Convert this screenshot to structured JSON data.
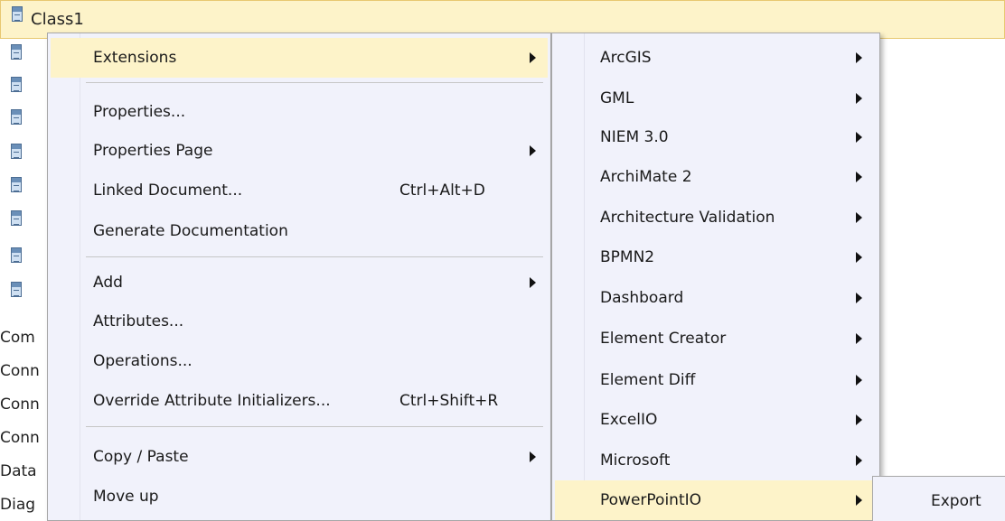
{
  "tree": {
    "root_label": "Class1",
    "items": [
      {
        "label": "Com"
      },
      {
        "label": "Conn"
      },
      {
        "label": "Conn"
      },
      {
        "label": "Conn"
      },
      {
        "label": "Data"
      },
      {
        "label": "Diag"
      }
    ]
  },
  "context_menu": {
    "items": [
      {
        "label": "Extensions",
        "submenu": true,
        "highlighted": true
      },
      {
        "label": "Properties..."
      },
      {
        "label": "Properties Page",
        "submenu": true
      },
      {
        "label": "Linked Document...",
        "shortcut": "Ctrl+Alt+D"
      },
      {
        "label": "Generate Documentation"
      },
      {
        "label": "Add",
        "submenu": true
      },
      {
        "label": "Attributes..."
      },
      {
        "label": "Operations..."
      },
      {
        "label": "Override Attribute Initializers...",
        "shortcut": "Ctrl+Shift+R"
      },
      {
        "label": "Copy / Paste",
        "submenu": true
      },
      {
        "label": "Move up"
      }
    ]
  },
  "extensions_menu": {
    "items": [
      {
        "label": "ArcGIS"
      },
      {
        "label": "GML"
      },
      {
        "label": "NIEM 3.0"
      },
      {
        "label": "ArchiMate 2"
      },
      {
        "label": "Architecture Validation"
      },
      {
        "label": "BPMN2"
      },
      {
        "label": "Dashboard"
      },
      {
        "label": "Element Creator"
      },
      {
        "label": "Element Diff"
      },
      {
        "label": "ExcelIO"
      },
      {
        "label": "Microsoft"
      },
      {
        "label": "PowerPointIO",
        "highlighted": true
      }
    ]
  },
  "powerpoint_menu": {
    "items": [
      {
        "label": "Export"
      }
    ]
  },
  "colors": {
    "highlight": "#fdf3c9",
    "menu_bg": "#f1f2fb",
    "menu_border": "#a7a7a7"
  },
  "icons": {
    "class_element": "class-element-icon",
    "submenu_arrow": "submenu-arrow-icon"
  }
}
